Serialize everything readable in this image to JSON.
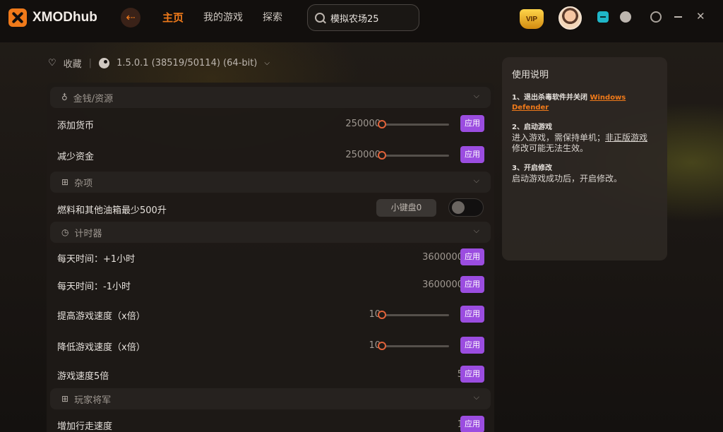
{
  "app": {
    "name": "XMODhub",
    "nav": [
      {
        "label": "主页"
      },
      {
        "label": "我的游戏"
      },
      {
        "label": "探索"
      }
    ],
    "search_value": "模拟农场25",
    "vip_label": "VIP"
  },
  "game_meta": {
    "favorite_label": "收藏",
    "version": "1.5.0.1 (38519/50114) (64-bit)"
  },
  "sections": {
    "money": {
      "title": "金钱/资源"
    },
    "misc": {
      "title": "杂项"
    },
    "timer": {
      "title": "计时器"
    },
    "player": {
      "title": "玩家将军"
    }
  },
  "rows": {
    "add_money": {
      "label": "添加货币",
      "value": "250000",
      "slider_fraction": 0.0,
      "apply": "应用"
    },
    "reduce_money": {
      "label": "减少资金",
      "value": "250000",
      "slider_fraction": 0.0,
      "apply": "应用"
    },
    "fuel": {
      "label": "燃料和其他油箱最少500升",
      "hotkey": "小键盘0",
      "enabled": false
    },
    "day_plus": {
      "label": "每天时间：+1小时",
      "value": "3600000",
      "apply": "应用"
    },
    "day_minus": {
      "label": "每天时间：-1小时",
      "value": "3600000",
      "apply": "应用"
    },
    "speed_up": {
      "label": "提高游戏速度（x倍）",
      "value": "10",
      "slider_fraction": 0.0,
      "apply": "应用"
    },
    "speed_down": {
      "label": "降低游戏速度（x倍）",
      "value": "10",
      "slider_fraction": 0.0,
      "apply": "应用"
    },
    "speed5": {
      "label": "游戏速度5倍",
      "value": "5",
      "apply": "应用"
    },
    "walk": {
      "label": "增加行走速度",
      "value": "1",
      "apply": "应用"
    }
  },
  "guide": {
    "title": "使用说明",
    "step1_title": "1、退出杀毒软件并关闭",
    "step1_link": "Windows Defender",
    "step2_title": "2、启动游戏",
    "step2_body_a": "进入游戏，需保持单机；",
    "step2_body_b": "非正版游戏",
    "step2_body_c": "修改可能无法生效。",
    "step3_title": "3、开启修改",
    "step3_body": "启动游戏成功后，开启修改。"
  },
  "colors": {
    "accent": "#f07a1a",
    "apply": "#9b4de0",
    "slider_knob": "#e0623a"
  }
}
